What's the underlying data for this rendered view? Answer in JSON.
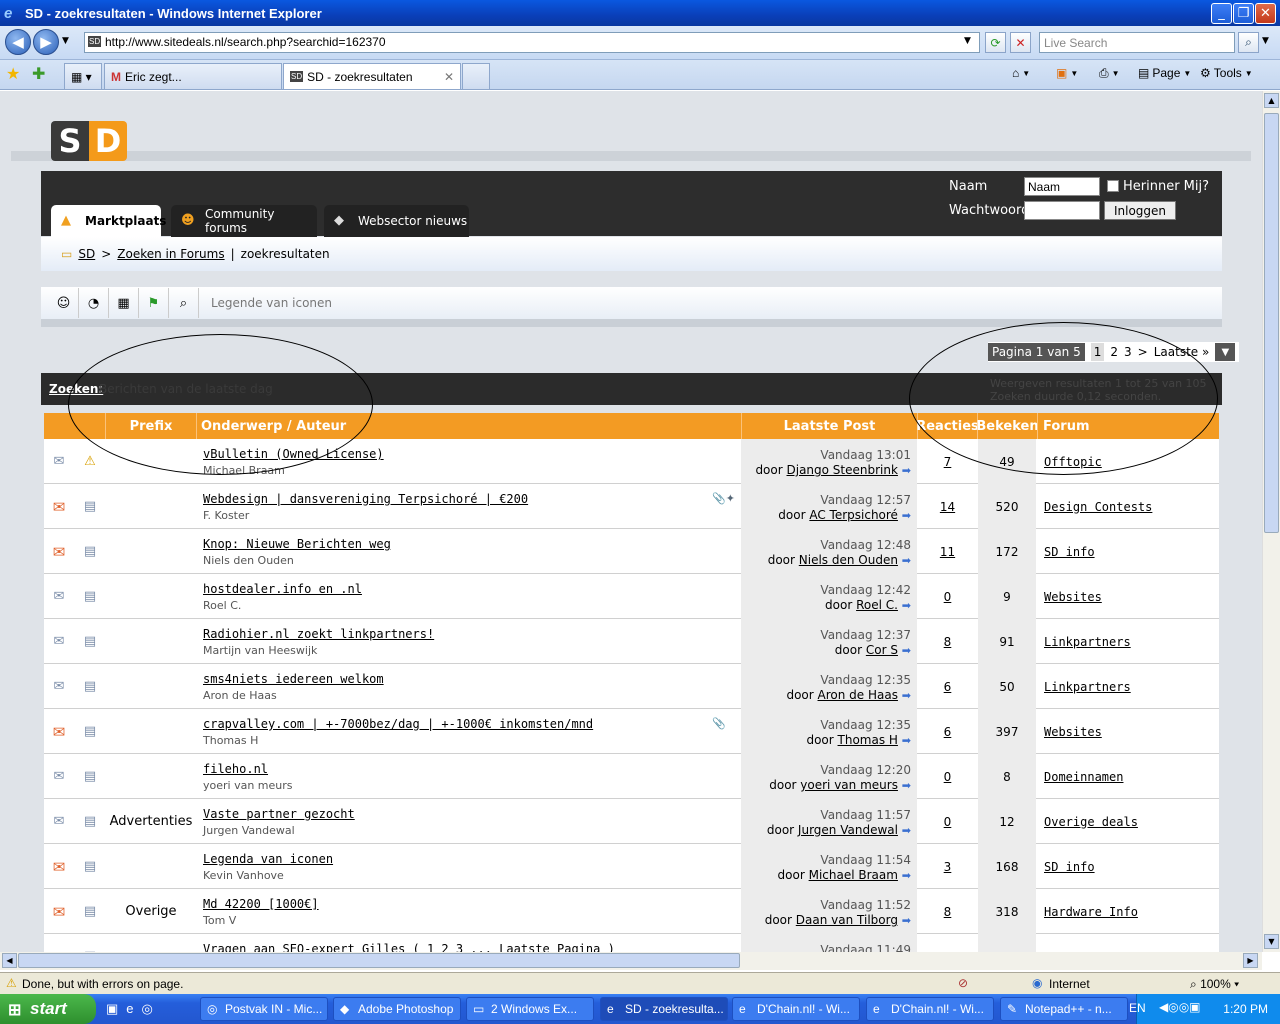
{
  "window": {
    "title": "SD - zoekresultaten - Windows Internet Explorer"
  },
  "browser": {
    "address": "http://www.sitedeals.nl/search.php?searchid=162370",
    "live_search_placeholder": "Live Search",
    "tabs": [
      {
        "label": "Eric zegt..."
      },
      {
        "label": "SD - zoekresultaten"
      }
    ],
    "page_label": "Page",
    "tools_label": "Tools"
  },
  "site": {
    "logo_s": "S",
    "logo_d": "D",
    "nav_tabs": [
      {
        "label": "Marktplaats",
        "icon": "cart-icon"
      },
      {
        "label": "Community forums",
        "icon": "people-icon"
      },
      {
        "label": "Websector nieuws",
        "icon": "tag-icon"
      }
    ],
    "login": {
      "name_label": "Naam",
      "name_value": "Naam",
      "remember_label": "Herinner Mij?",
      "password_label": "Wachtwoord",
      "login_button": "Inloggen"
    },
    "breadcrumb": {
      "root": "SD",
      "sep": ">",
      "link": "Zoeken in Forums",
      "sep2": "|",
      "current": "zoekresultaten"
    },
    "iconbar": {
      "legend": "Legende van iconen"
    },
    "pagination": {
      "label": "Pagina 1 van 5",
      "pages": [
        "1",
        "2",
        "3"
      ],
      "next": ">",
      "last": "Laatste »"
    },
    "search": {
      "label": "Zoeken:",
      "subtitle": "Berichten van de laatste dag",
      "results_line1": "Weergeven resultaten 1 tot 25 van 105",
      "results_line2": "Zoeken duurde 0,12 seconden."
    },
    "table": {
      "headers": {
        "prefix": "Prefix",
        "subject": "Onderwerp / Auteur",
        "last_post": "Laatste Post",
        "replies": "Reacties",
        "views": "Bekeken",
        "forum": "Forum"
      },
      "rows": [
        {
          "prefix": "",
          "subject": "vBulletin (Owned License)",
          "author": "Michael Braam",
          "date": "Vandaag 13:01",
          "by": "door",
          "poster": "Django Steenbrink",
          "replies": "7",
          "views": "49",
          "forum": "Offtopic",
          "hot": false,
          "icon2": "warning-icon",
          "att": ""
        },
        {
          "prefix": "",
          "subject": "Webdesign | dansvereniging Terpsichoré | €200",
          "author": "F. Koster",
          "date": "Vandaag 12:57",
          "by": "door",
          "poster": "AC Terpsichoré",
          "replies": "14",
          "views": "520",
          "forum": "Design Contests",
          "hot": true,
          "icon2": "doc-icon",
          "att": "📎✦"
        },
        {
          "prefix": "",
          "subject": "Knop: Nieuwe Berichten weg",
          "author": "Niels den Ouden",
          "date": "Vandaag 12:48",
          "by": "door",
          "poster": "Niels den Ouden",
          "replies": "11",
          "views": "172",
          "forum": "SD info",
          "hot": true,
          "icon2": "doc-icon",
          "att": ""
        },
        {
          "prefix": "",
          "subject": "hostdealer.info en .nl",
          "author": "Roel C.",
          "date": "Vandaag 12:42",
          "by": "door",
          "poster": "Roel C.",
          "replies": "0",
          "views": "9",
          "forum": "Websites",
          "hot": false,
          "icon2": "doc-icon",
          "att": ""
        },
        {
          "prefix": "",
          "subject": "Radiohier.nl zoekt linkpartners!",
          "author": "Martijn van Heeswijk",
          "date": "Vandaag 12:37",
          "by": "door",
          "poster": "Cor S",
          "replies": "8",
          "views": "91",
          "forum": "Linkpartners",
          "hot": false,
          "icon2": "doc-icon",
          "att": ""
        },
        {
          "prefix": "",
          "subject": "sms4niets iedereen welkom",
          "author": "Aron de Haas",
          "date": "Vandaag 12:35",
          "by": "door",
          "poster": "Aron de Haas",
          "replies": "6",
          "views": "50",
          "forum": "Linkpartners",
          "hot": false,
          "icon2": "doc-icon",
          "att": ""
        },
        {
          "prefix": "",
          "subject": "crapvalley.com | +-7000bez/dag | +-1000€ inkomsten/mnd",
          "author": "Thomas H",
          "date": "Vandaag 12:35",
          "by": "door",
          "poster": "Thomas H",
          "replies": "6",
          "views": "397",
          "forum": "Websites",
          "hot": true,
          "icon2": "doc-icon",
          "att": "📎"
        },
        {
          "prefix": "",
          "subject": "fileho.nl",
          "author": "yoeri van meurs",
          "date": "Vandaag 12:20",
          "by": "door",
          "poster": "yoeri van meurs",
          "replies": "0",
          "views": "8",
          "forum": "Domeinnamen",
          "hot": false,
          "icon2": "doc-icon",
          "att": ""
        },
        {
          "prefix": "Advertenties",
          "subject": "Vaste partner gezocht",
          "author": "Jurgen Vandewal",
          "date": "Vandaag 11:57",
          "by": "door",
          "poster": "Jurgen Vandewal",
          "replies": "0",
          "views": "12",
          "forum": "Overige deals",
          "hot": false,
          "icon2": "doc-icon",
          "att": ""
        },
        {
          "prefix": "",
          "subject": "Legenda van iconen",
          "author": "Kevin Vanhove",
          "date": "Vandaag 11:54",
          "by": "door",
          "poster": "Michael Braam",
          "replies": "3",
          "views": "168",
          "forum": "SD info",
          "hot": true,
          "icon2": "doc-icon",
          "att": ""
        },
        {
          "prefix": "Overige",
          "subject": "Md 42200 [1000€]",
          "author": "Tom V",
          "date": "Vandaag 11:52",
          "by": "door",
          "poster": "Daan van Tilborg",
          "replies": "8",
          "views": "318",
          "forum": "Hardware Info",
          "hot": true,
          "icon2": "doc-icon",
          "att": ""
        },
        {
          "prefix": "",
          "subject": "Vragen aan SEO-expert Gilles ( 1 2 3 ... Laatste Pagina )",
          "author": "",
          "date": "Vandaag 11:49",
          "by": "",
          "poster": "",
          "replies": "",
          "views": "",
          "forum": "",
          "hot": true,
          "icon2": "doc-icon",
          "att": ""
        }
      ]
    }
  },
  "status": {
    "text": "Done, but with errors on page.",
    "zone": "Internet",
    "zoom": "100%"
  },
  "taskbar": {
    "start": "start",
    "tasks": [
      "Postvak IN - Mic...",
      "Adobe Photoshop",
      "2 Windows Ex...",
      "SD - zoekresulta...",
      "D'Chain.nl! - Wi...",
      "D'Chain.nl! - Wi...",
      "Notepad++ - n..."
    ],
    "lang": "EN",
    "clock": "1:20 PM"
  }
}
